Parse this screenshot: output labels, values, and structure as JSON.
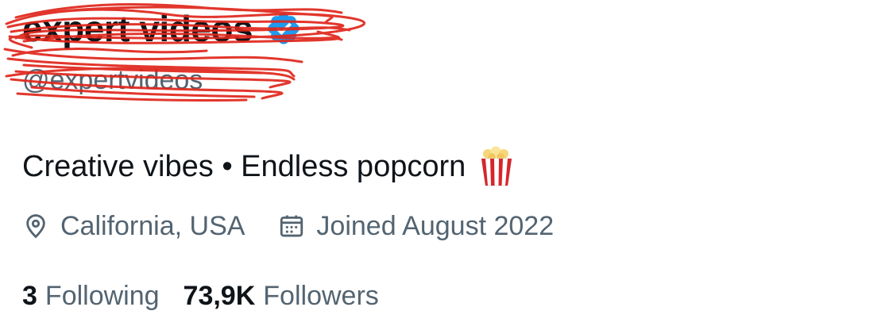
{
  "profile": {
    "display_name": "expert videos",
    "handle": "@expertvideos",
    "verified": true,
    "bio": "Creative vibes • Endless popcorn",
    "bio_emoji": "popcorn-icon",
    "location": "California, USA",
    "joined": "Joined August 2022",
    "following_count": "3",
    "following_label": "Following",
    "followers_count": "73,9K",
    "followers_label": "Followers"
  },
  "icons": {
    "verified": "verified-badge-icon",
    "location": "location-pin-icon",
    "calendar": "calendar-icon"
  },
  "colors": {
    "verified_blue": "#1d9bf0",
    "secondary_text": "#536471",
    "primary_text": "#0f1419",
    "redaction_red": "#e0261b"
  }
}
